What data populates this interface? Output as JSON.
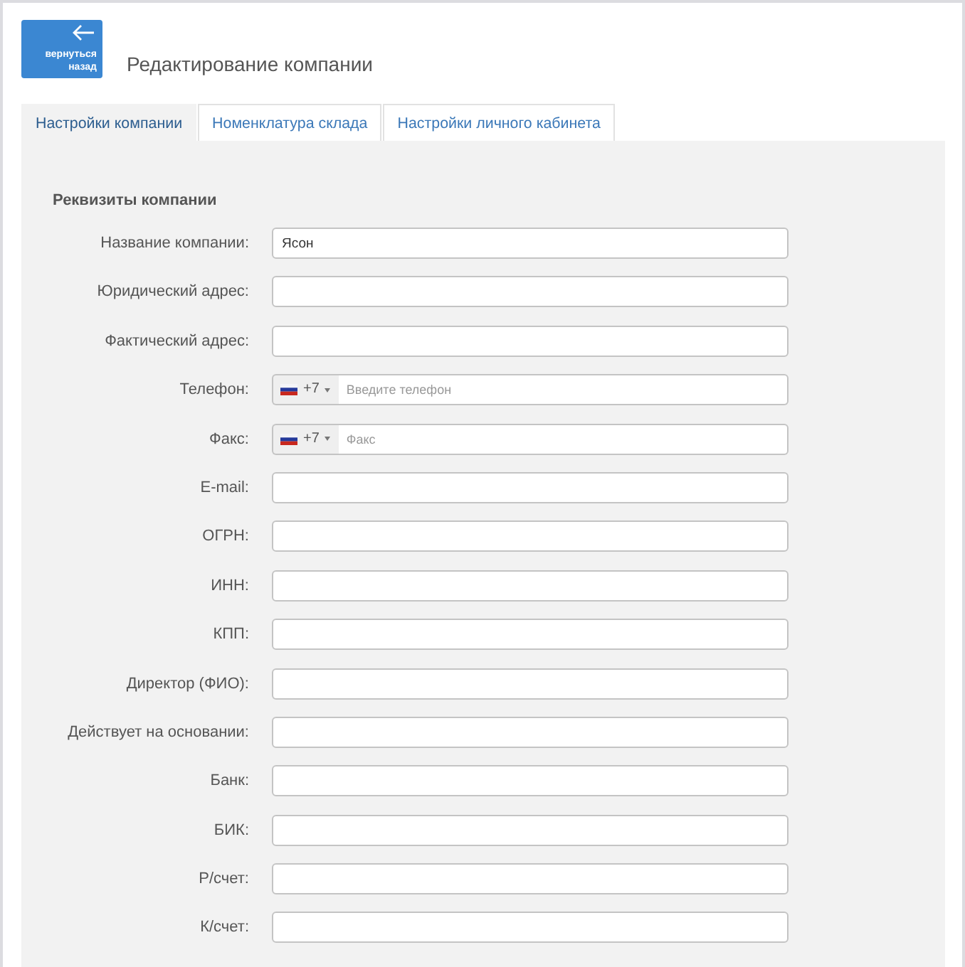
{
  "header": {
    "back_button": {
      "label": "вернуться назад"
    },
    "title": "Редактирование компании"
  },
  "tabs": [
    {
      "label": "Настройки компании",
      "selected": true
    },
    {
      "label": "Номенклатура склада",
      "selected": false
    },
    {
      "label": "Настройки личного кабинета",
      "selected": false
    }
  ],
  "section": {
    "title": "Реквизиты компании",
    "fields": [
      {
        "kind": "text",
        "label": "Название компании:",
        "value": "Ясон"
      },
      {
        "kind": "text",
        "label": "Юридический адрес:"
      },
      {
        "kind": "text",
        "label": "Фактический адрес:"
      },
      {
        "kind": "phone",
        "label": "Телефон:",
        "code": "+7",
        "placeholder": "Введите телефон"
      },
      {
        "kind": "phone",
        "label": "Факс:",
        "code": "+7",
        "placeholder": "Факс"
      },
      {
        "kind": "text",
        "label": "E-mail:"
      },
      {
        "kind": "text",
        "label": "ОГРН:"
      },
      {
        "kind": "text",
        "label": "ИНН:"
      },
      {
        "kind": "text",
        "label": "КПП:"
      },
      {
        "kind": "text",
        "label": "Директор (ФИО):"
      },
      {
        "kind": "text",
        "label": "Действует на основании:"
      },
      {
        "kind": "text",
        "label": "Банк:"
      },
      {
        "kind": "text",
        "label": "БИК:"
      },
      {
        "kind": "text",
        "label": "Р/счет:"
      },
      {
        "kind": "text",
        "label": "К/счет:"
      }
    ]
  }
}
